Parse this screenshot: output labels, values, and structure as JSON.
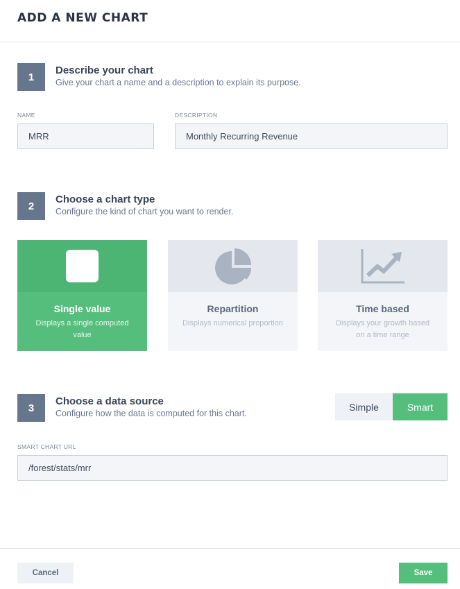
{
  "header": {
    "title": "ADD A NEW CHART"
  },
  "steps": [
    {
      "number": "1",
      "title": "Describe your chart",
      "description": "Give your chart a name and a description to explain its purpose."
    },
    {
      "number": "2",
      "title": "Choose a chart type",
      "description": "Configure the kind of chart you want to render."
    },
    {
      "number": "3",
      "title": "Choose a data source",
      "description": "Configure how the data is computed for this chart."
    }
  ],
  "fields": {
    "name": {
      "label": "NAME",
      "value": "MRR"
    },
    "description": {
      "label": "DESCRIPTION",
      "value": "Monthly Recurring Revenue"
    },
    "smart_url": {
      "label": "SMART CHART URL",
      "value": "/forest/stats/mrr"
    }
  },
  "chart_types": [
    {
      "title": "Single value",
      "description": "Displays a single computed value",
      "icon": "square-icon",
      "selected": true
    },
    {
      "title": "Repartition",
      "description": "Displays numerical proportion",
      "icon": "pie-chart-icon",
      "selected": false
    },
    {
      "title": "Time based",
      "description": "Displays your growth based on a time range",
      "icon": "line-chart-icon",
      "selected": false
    }
  ],
  "data_source": {
    "options": [
      "Simple",
      "Smart"
    ],
    "selected": "Smart"
  },
  "footer": {
    "cancel_label": "Cancel",
    "save_label": "Save"
  },
  "colors": {
    "accent_green": "#55be7d",
    "step_badge": "#66778d",
    "muted_card": "#f3f5f9",
    "icon_gray": "#a9b3c1"
  }
}
